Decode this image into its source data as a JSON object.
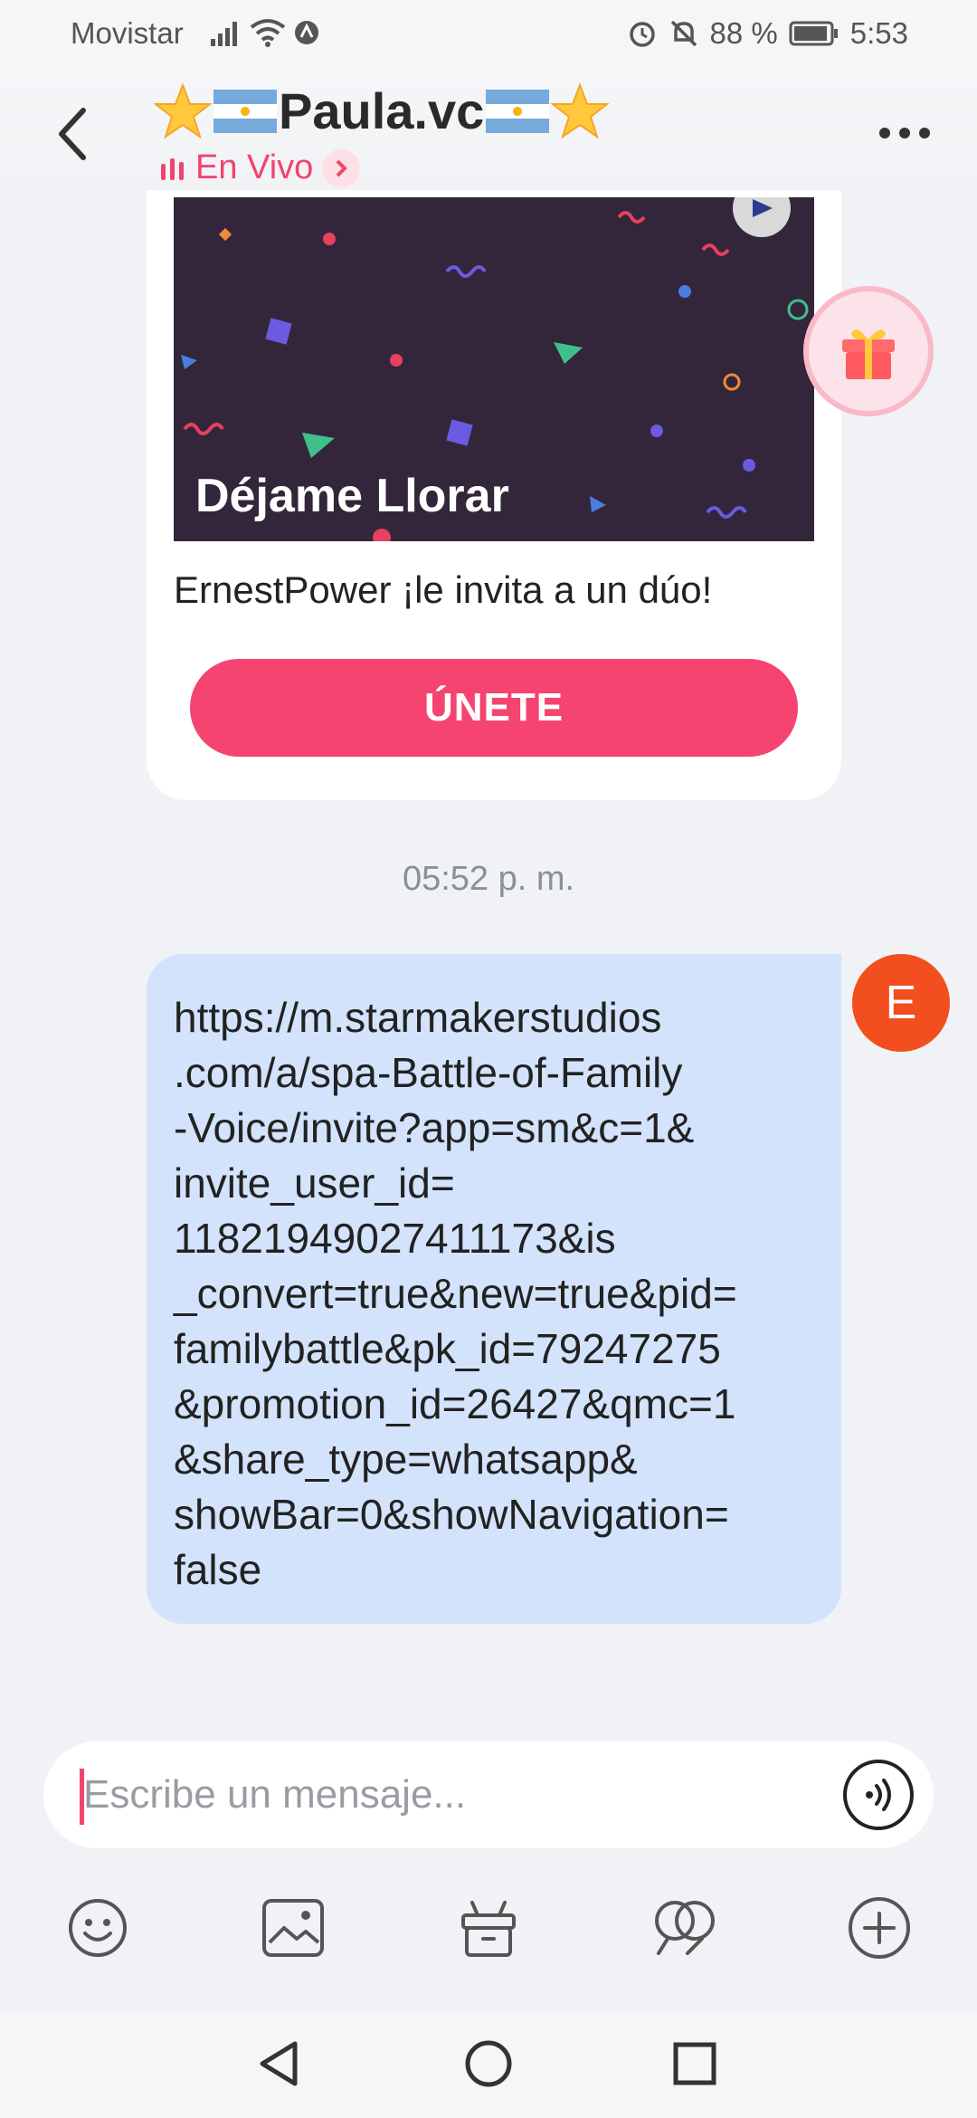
{
  "status_bar": {
    "carrier": "Movistar",
    "battery": "88 %",
    "time": "5:53"
  },
  "header": {
    "title": "Paula.vc",
    "live_label": "En Vivo"
  },
  "invite_card": {
    "song_title": "Déjame Llorar",
    "invite_text": "ErnestPower ¡le invita a un dúo!",
    "join_label": "ÚNETE"
  },
  "timestamp": "05:52 p. m.",
  "message": {
    "avatar_initial": "E",
    "lines": [
      "https://m.starmakerstudios",
      ".com/a/spa-Battle-of-Family",
      "-Voice/invite?app=sm&c=1&",
      "invite_user_id=",
      "11821949027411173&is",
      "_convert=true&new=true&pid=",
      "familybattle&pk_id=79247275",
      "&promotion_id=26427&qmc=1",
      "&share_type=whatsapp&",
      "showBar=0&showNavigation=",
      "false"
    ]
  },
  "composer": {
    "placeholder": "Escribe un mensaje..."
  },
  "icons": {
    "toolbar": [
      "emoji-icon",
      "image-icon",
      "gift-icon",
      "duet-icon",
      "plus-icon"
    ],
    "nav": [
      "back-nav-icon",
      "home-nav-icon",
      "recents-nav-icon"
    ]
  },
  "colors": {
    "accent": "#f5446f",
    "bubble": "#d3e3fb",
    "avatar": "#f24e1e",
    "banner": "#33263a"
  }
}
